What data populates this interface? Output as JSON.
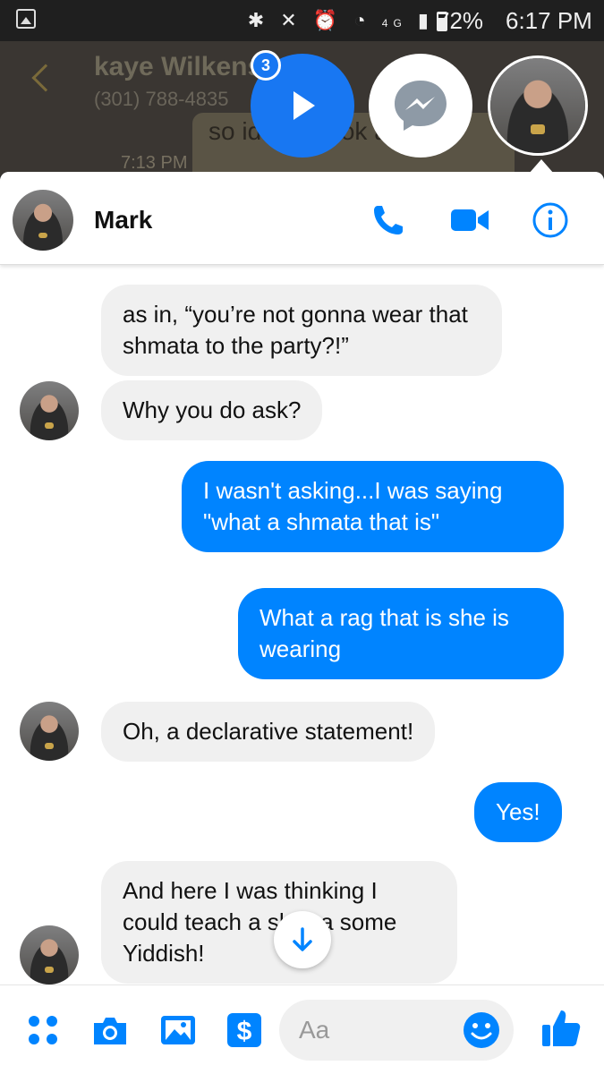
{
  "status_bar": {
    "battery": "72%",
    "time": "6:17 PM",
    "network": "4G"
  },
  "background_app": {
    "contact_name": "kaye Wilkenso",
    "contact_phone": "(301) 788-4835",
    "bubble_text": "so id           D          ti book at him.",
    "timestamp": "7:13 PM"
  },
  "chat_heads": {
    "badge_count": "3"
  },
  "chat": {
    "contact_name": "Mark",
    "header_icons": [
      "phone-icon",
      "video-camera-icon",
      "info-icon"
    ]
  },
  "messages": [
    {
      "sender": "Mark",
      "direction": "incoming",
      "text": "as in, “you’re not gonna wear that shmata to the party?!”"
    },
    {
      "sender": "Mark",
      "direction": "incoming",
      "text": "Why you do ask?"
    },
    {
      "sender": "me",
      "direction": "outgoing",
      "text": "I wasn't asking...I was saying \"what a shmata that is\""
    },
    {
      "sender": "me",
      "direction": "outgoing",
      "text": "What a rag that is she is wearing"
    },
    {
      "sender": "Mark",
      "direction": "incoming",
      "text": "Oh, a declarative statement!"
    },
    {
      "sender": "me",
      "direction": "outgoing",
      "text": "Yes!"
    },
    {
      "sender": "Mark",
      "direction": "incoming",
      "text": "And here I was thinking I could teach a shiksa some Yiddish!"
    }
  ],
  "composer": {
    "placeholder": "Aa",
    "icons": [
      "apps-icon",
      "camera-icon",
      "gallery-icon",
      "payment-icon",
      "emoji-icon",
      "like-icon"
    ]
  },
  "colors": {
    "messenger_blue": "#0084ff",
    "incoming_bubble": "#f0f0f0"
  }
}
